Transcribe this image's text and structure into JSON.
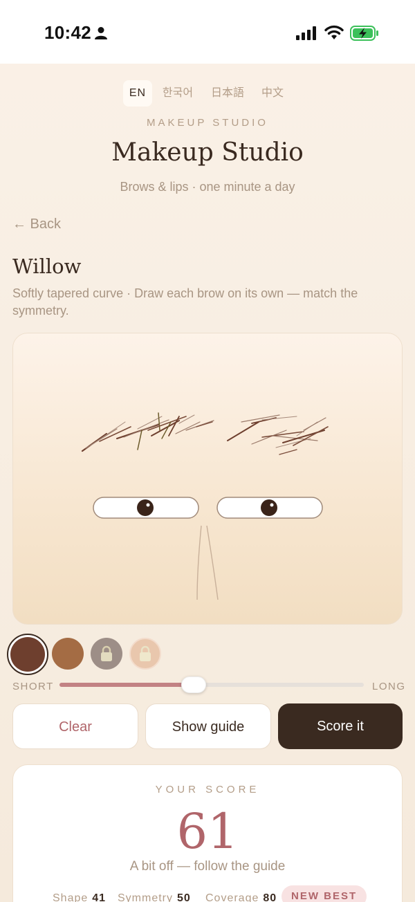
{
  "status": {
    "time": "10:42"
  },
  "languages": [
    {
      "label": "EN",
      "active": true
    },
    {
      "label": "한국어",
      "active": false
    },
    {
      "label": "日本語",
      "active": false
    },
    {
      "label": "中文",
      "active": false
    }
  ],
  "header": {
    "overline": "MAKEUP STUDIO",
    "title": "Makeup Studio",
    "subtitle": "Brows & lips · one minute a day"
  },
  "nav": {
    "back_label": "← Back"
  },
  "style": {
    "name": "Willow",
    "description": "Softly tapered curve · Draw each brow on its own — match the symmetry."
  },
  "swatches": [
    {
      "color": "#6e3f2e",
      "locked": false,
      "selected": true
    },
    {
      "color": "#a46c44",
      "locked": false,
      "selected": false
    },
    {
      "color": "#9d8e87",
      "locked": true,
      "selected": false
    },
    {
      "color": "#e9c7ad",
      "locked": true,
      "selected": false
    }
  ],
  "length": {
    "min_label": "SHORT",
    "max_label": "LONG",
    "value": 0.44
  },
  "actions": {
    "clear": "Clear",
    "guide": "Show guide",
    "score": "Score it"
  },
  "score": {
    "label": "YOUR SCORE",
    "value": "61",
    "message": "A bit off — follow the guide",
    "metrics": [
      {
        "label": "Shape",
        "value": "41"
      },
      {
        "label": "Symmetry",
        "value": "50"
      },
      {
        "label": "Coverage",
        "value": "80"
      }
    ],
    "badge": "NEW BEST"
  },
  "colors": {
    "accent": "#b0656a",
    "dark": "#3a2a20",
    "muted": "#a89583"
  }
}
